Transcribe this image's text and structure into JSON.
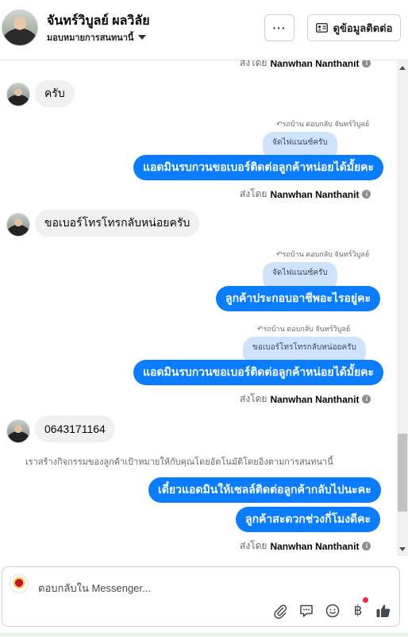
{
  "header": {
    "contact_name": "จันทร์วิบูลย์ ผลวิลัย",
    "assign_label": "มอบหมายการสนทนานี้",
    "more_label": "···",
    "contact_info_label": "ดูข้อมูลติดต่อ"
  },
  "thread": {
    "sent_prefix": "ส่งโดย",
    "agent_name": "Nanwhan Nanthanit",
    "messages": [
      {
        "id": "in1",
        "text": "ครับ"
      },
      {
        "id": "reply1_label",
        "text": "รถบ้าน ตอบกลับ จันทร์วิบูลย์"
      },
      {
        "id": "quote1",
        "text": "จัดไฟแนนซ์ครับ"
      },
      {
        "id": "out1",
        "text": "แอดมินรบกวนขอเบอร์ติดต่อลูกค้าหน่อยได้มั้ยคะ"
      },
      {
        "id": "in2",
        "text": "ขอเบอร์โทรโทรกลับหน่อยครับ"
      },
      {
        "id": "reply2_label",
        "text": "รถบ้าน ตอบกลับ จันทร์วิบูลย์"
      },
      {
        "id": "quote2",
        "text": "จัดไฟแนนซ์ครับ"
      },
      {
        "id": "out2",
        "text": "ลูกค้าประกอบอาชีพอะไรอยู่คะ"
      },
      {
        "id": "reply3_label",
        "text": "รถบ้าน ตอบกลับ จันทร์วิบูลย์"
      },
      {
        "id": "quote3",
        "text": "ขอเบอร์โทรโทรกลับหน่อยครับ"
      },
      {
        "id": "out3",
        "text": "แอดมินรบกวนขอเบอร์ติดต่อลูกค้าหน่อยได้มั้ยคะ"
      },
      {
        "id": "in3",
        "text": "0643171164"
      },
      {
        "id": "system",
        "text": "เราสร้างกิจกรรมของลูกค้าเป้าหมายให้กับคุณโดยอัตโนมัติโดยอิงตามการสนทนานี้"
      },
      {
        "id": "out4",
        "text": "เดี๋ยวแอดมินให้เซลล์ติดต่อลูกค้ากลับไปนะคะ"
      },
      {
        "id": "out5",
        "text": "ลูกค้าสะดวกช่วงกี่โมงดีคะ"
      }
    ]
  },
  "composer": {
    "placeholder": "ตอบกลับใน Messenger...",
    "baht_symbol": "฿"
  },
  "colors": {
    "outgoing_bubble": "#0a7cff",
    "incoming_bubble": "#f0f0f0",
    "quote_bubble": "#cfe3fd",
    "notification_dot": "#f02849"
  },
  "icons": [
    "chevron-down-icon",
    "contact-card-icon",
    "info-icon",
    "reply-arrow-icon",
    "paperclip-icon",
    "chat-bubble-icon",
    "emoji-icon",
    "baht-icon",
    "thumbs-up-icon"
  ]
}
